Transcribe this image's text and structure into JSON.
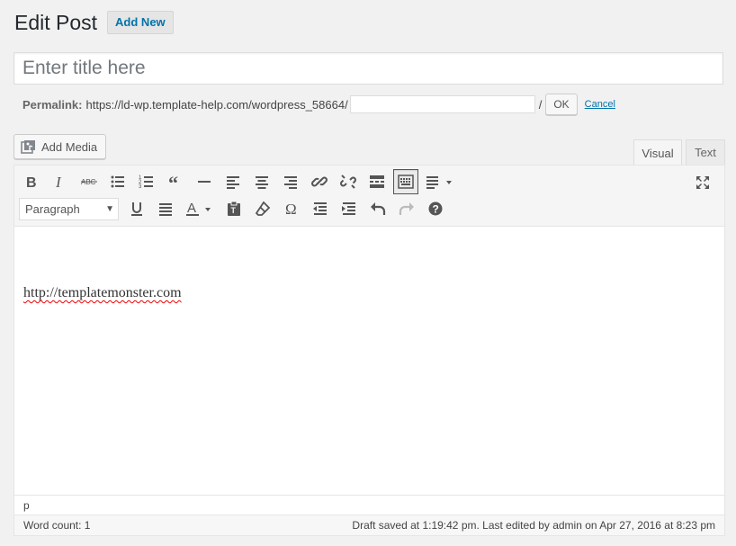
{
  "header": {
    "title": "Edit Post",
    "add_new_label": "Add New"
  },
  "title_field": {
    "placeholder": "Enter title here",
    "value": ""
  },
  "permalink": {
    "label": "Permalink:",
    "base_url": "https://ld-wp.template-help.com/wordpress_58664/",
    "slug_value": "",
    "slash": "/",
    "ok_label": "OK",
    "cancel_label": "Cancel"
  },
  "media": {
    "add_media_label": "Add Media"
  },
  "tabs": {
    "visual": "Visual",
    "text": "Text"
  },
  "toolbar": {
    "row1_icons": [
      "bold-icon",
      "italic-icon",
      "strikethrough-icon",
      "bulleted-list-icon",
      "numbered-list-icon",
      "blockquote-icon",
      "horizontal-line-icon",
      "align-left-icon",
      "align-center-icon",
      "align-right-icon",
      "insert-link-icon",
      "remove-link-icon",
      "read-more-icon",
      "toolbar-toggle-icon",
      "table-align-icon"
    ],
    "format_select": "Paragraph",
    "row2_icons": [
      "underline-icon",
      "justify-icon",
      "text-color-icon",
      "paste-as-text-icon",
      "clear-formatting-icon",
      "special-character-icon",
      "outdent-icon",
      "indent-icon",
      "undo-icon",
      "redo-icon",
      "help-icon"
    ]
  },
  "editor": {
    "content": "http://templatemonster.com"
  },
  "path_bar": {
    "path": "p"
  },
  "status": {
    "word_count": "Word count: 1",
    "draft_saved": "Draft saved at 1:19:42 pm. Last edited by admin on Apr 27, 2016 at 8:23 pm"
  },
  "colors": {
    "link": "#0073aa",
    "background": "#f1f1f1",
    "icon": "#555555"
  }
}
